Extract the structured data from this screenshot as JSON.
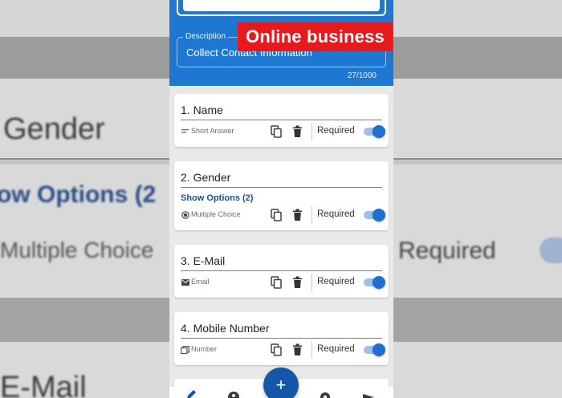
{
  "overlay": {
    "banner": "Online business"
  },
  "background_zoom": {
    "question_title": "Gender",
    "show_options": "ow Options (2",
    "type_label": "Multiple Choice",
    "required_label": "Required",
    "next_title": "E-Mail"
  },
  "form_header": {
    "description_label": "Description",
    "description_value": "Collect Contact Information",
    "char_counter": "27/1000"
  },
  "questions": [
    {
      "title": "1. Name",
      "type": "Short Answer",
      "type_icon": "short-answer-icon",
      "required_label": "Required",
      "required": true
    },
    {
      "title": "2. Gender",
      "options_link": "Show Options (2)",
      "type": "Multiple Choice",
      "type_icon": "radio-icon",
      "required_label": "Required",
      "required": true
    },
    {
      "title": "3. E-Mail",
      "type": "Email",
      "type_icon": "mail-icon",
      "required_label": "Required",
      "required": true
    },
    {
      "title": "4. Mobile Number",
      "type": "Number",
      "type_icon": "number-icon",
      "required_label": "Required",
      "required": true
    }
  ],
  "fab": {
    "label": "+"
  },
  "bottom_nav": [
    "edit-icon",
    "palette-icon",
    "settings-icon",
    "send-icon"
  ],
  "colors": {
    "header": "#1e78d2",
    "accent": "#1e6fd1",
    "fab": "#1358a8",
    "banner": "#e8191b"
  }
}
